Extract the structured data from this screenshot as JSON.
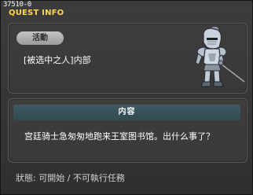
{
  "window": {
    "quest_id": "37510-0",
    "title": "QUEST INFO"
  },
  "quest": {
    "category": "活動",
    "name": "[被选中之人]内部",
    "npc_icon": "armored-knight-sprite"
  },
  "content": {
    "header": "内容",
    "description": "宫廷骑士急匆匆地跑来王室图书馆。出什么事了？"
  },
  "status": {
    "text": "狀態: 可開始 / 不可執行任務"
  },
  "colors": {
    "title_accent": "#ffd84a",
    "header_bar": "#3e5a63",
    "background": "#363636"
  }
}
